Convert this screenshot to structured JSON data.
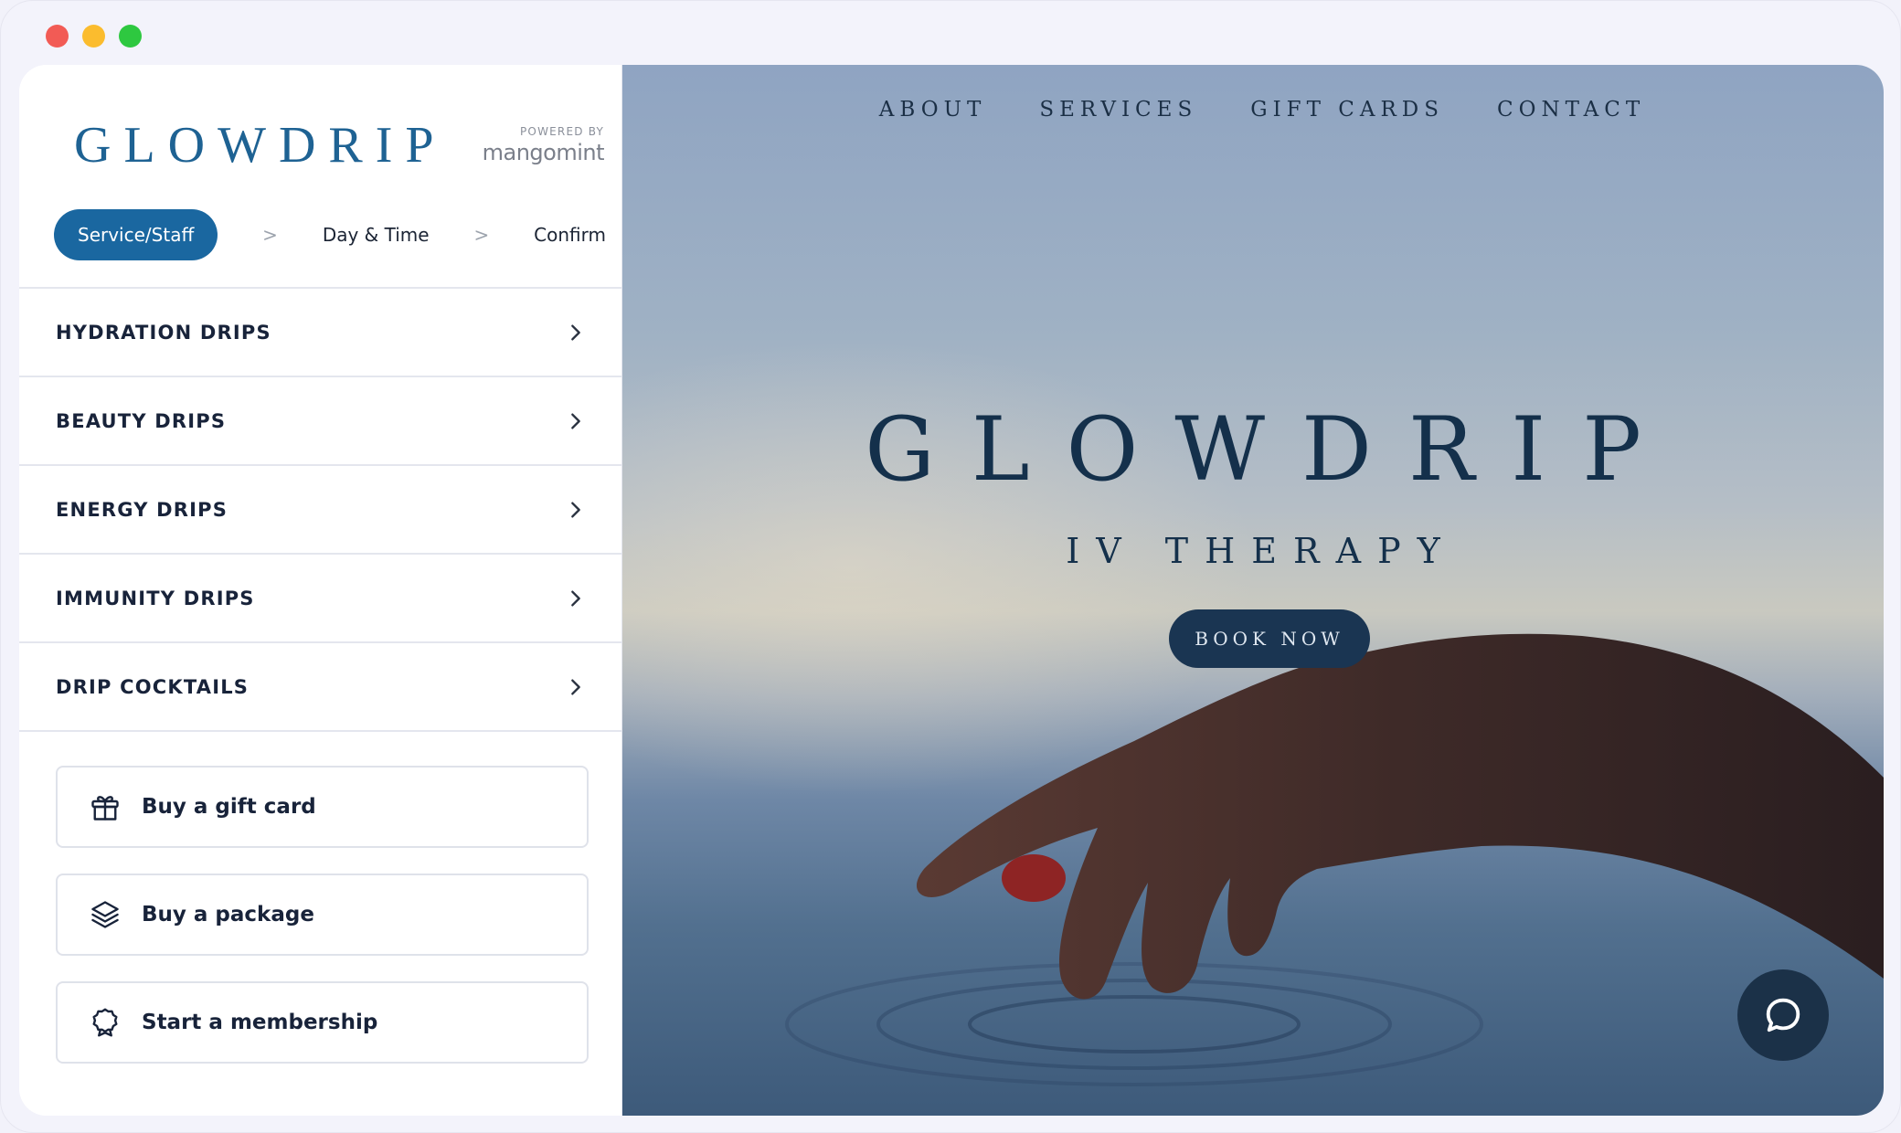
{
  "brand": {
    "logo": "GLOWDRIP",
    "powered_label": "POWERED BY",
    "powered_brand": "mangomint"
  },
  "steps": {
    "active": "Service/Staff",
    "separator": ">",
    "day_time": "Day & Time",
    "confirm": "Confirm"
  },
  "categories": [
    {
      "label": "HYDRATION DRIPS"
    },
    {
      "label": "BEAUTY DRIPS"
    },
    {
      "label": "ENERGY DRIPS"
    },
    {
      "label": "IMMUNITY DRIPS"
    },
    {
      "label": "DRIP COCKTAILS"
    }
  ],
  "actions": {
    "gift_card": {
      "label": "Buy a gift card",
      "icon": "gift-icon"
    },
    "package": {
      "label": "Buy a package",
      "icon": "layers-icon"
    },
    "membership": {
      "label": "Start a membership",
      "icon": "badge-icon"
    }
  },
  "hero": {
    "nav": [
      "ABOUT",
      "SERVICES",
      "GIFT CARDS",
      "CONTACT"
    ],
    "title": "GLOWDRIP",
    "subtitle": "IV THERAPY",
    "cta": "BOOK NOW"
  },
  "colors": {
    "accent": "#1a67a0",
    "logo": "#1e6293",
    "navy": "#1a3552",
    "text": "#18233a"
  }
}
